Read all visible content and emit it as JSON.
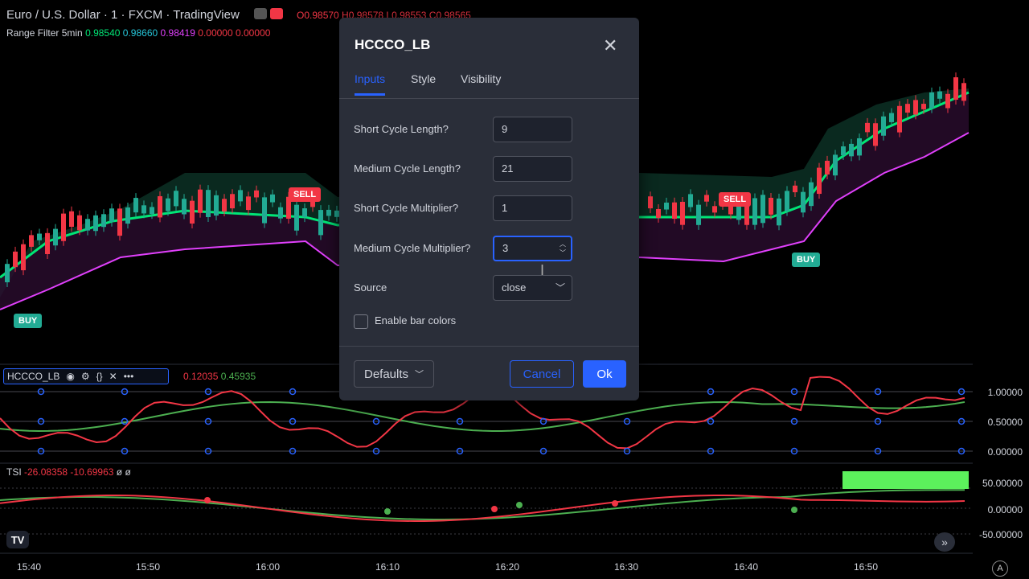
{
  "header": {
    "symbol_title": "Euro / U.S. Dollar · 1 · FXCM · TradingView",
    "ohlc": "O0.98570 H0.98578 L0.98553 C0.98565"
  },
  "range_filter": {
    "name": "Range Filter 5min",
    "v1": "0.98540",
    "v2": "0.98660",
    "v3": "0.98419",
    "v4": "0.00000",
    "v5": "0.00000"
  },
  "signals": {
    "sell": "SELL",
    "buy": "BUY"
  },
  "indicator_bar": {
    "name": "HCCCO_LB",
    "icons": [
      "eye-icon",
      "settings-icon",
      "source-code-icon",
      "close-icon",
      "more-icon"
    ],
    "value1": "0.12035",
    "value2": "0.45935"
  },
  "osc_scale": [
    "1.00000",
    "0.50000",
    "0.00000"
  ],
  "tsi": {
    "name": "TSI",
    "value1": "-26.08358",
    "value2": "-10.69963",
    "value3": "ø ø"
  },
  "tsi_scale": [
    "50.00000",
    "0.00000",
    "-50.00000"
  ],
  "time_axis": [
    "15:40",
    "15:50",
    "16:00",
    "16:10",
    "16:20",
    "16:30",
    "16:40",
    "16:50"
  ],
  "dialog": {
    "title": "HCCCO_LB",
    "tabs": [
      "Inputs",
      "Style",
      "Visibility"
    ],
    "active_tab": "Inputs",
    "inputs": [
      {
        "label": "Short Cycle Length?",
        "value": "9"
      },
      {
        "label": "Medium Cycle Length?",
        "value": "21"
      },
      {
        "label": "Short Cycle Multiplier?",
        "value": "1"
      },
      {
        "label": "Medium Cycle Multiplier?",
        "value": "3"
      }
    ],
    "source": {
      "label": "Source",
      "value": "close"
    },
    "checkbox": {
      "label": "Enable bar colors",
      "checked": false
    },
    "defaults_label": "Defaults",
    "cancel_label": "Cancel",
    "ok_label": "Ok"
  },
  "colors": {
    "accent": "#2962ff",
    "up": "#22ab94",
    "down": "#f23645",
    "upper_band": "#00e676",
    "lower_band": "#e040fb",
    "osc_fast": "#f23645",
    "osc_slow": "#4caf50"
  }
}
